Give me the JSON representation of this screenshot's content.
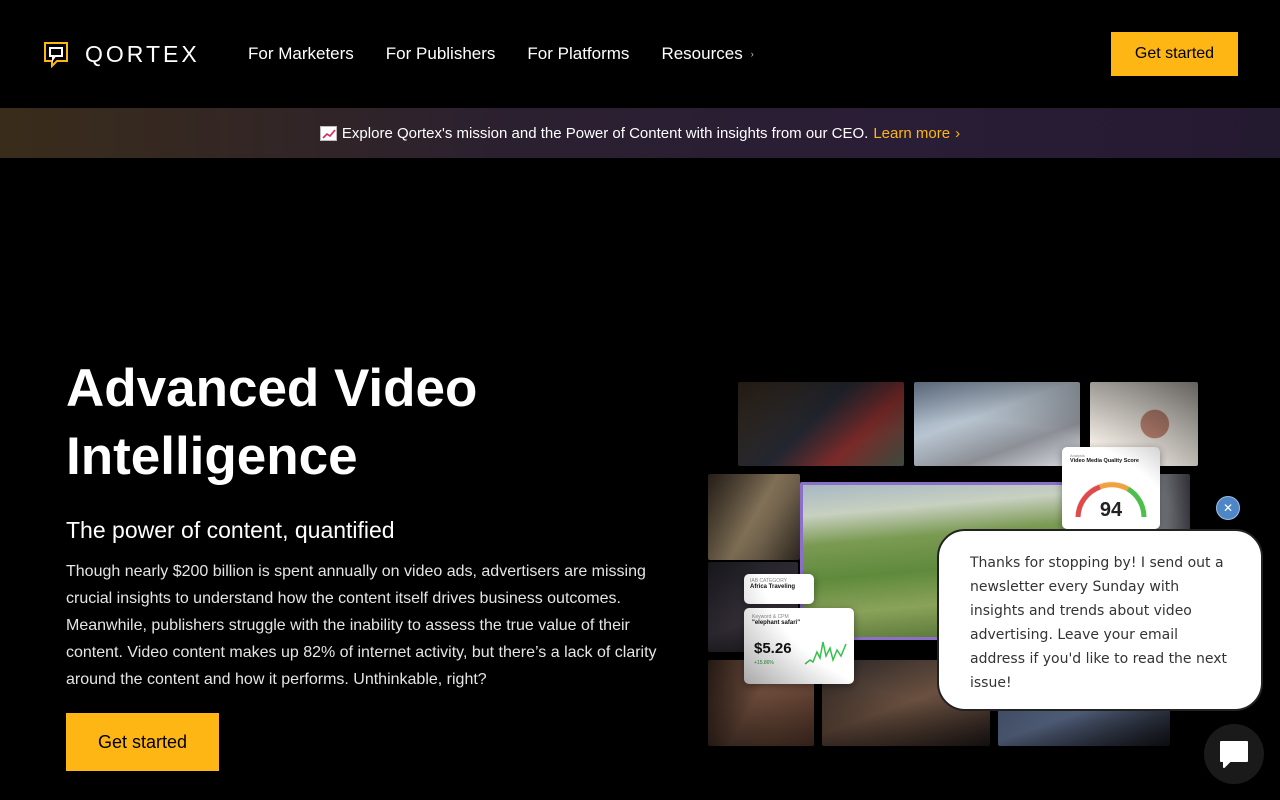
{
  "brand": {
    "name": "QORTEX",
    "accent_color": "#fdb614"
  },
  "nav": {
    "items": [
      {
        "label": "For Marketers"
      },
      {
        "label": "For Publishers"
      },
      {
        "label": "For Platforms"
      },
      {
        "label": "Resources",
        "icon": "chevron-right-icon"
      }
    ],
    "cta_label": "Get started"
  },
  "announcement": {
    "emoji_icon": "chart-increasing-icon",
    "text": "Explore Qortex's mission and the Power of Content with insights from our CEO.",
    "link_label": "Learn more",
    "link_icon": "chevron-right-icon"
  },
  "hero": {
    "title": "Advanced Video Intelligence",
    "subtitle": "The power of content, quantified",
    "body": "Though nearly $200 billion is spent annually on video ads, advertisers are missing crucial insights to understand how the content itself drives business outcomes. Meanwhile, publishers struggle with the inability to assess the true value of their content. Video content makes up 82% of internet activity, but there’s a lack of clarity around the content and how it performs. Unthinkable, right?",
    "cta_label": "Get started"
  },
  "collage": {
    "score_card": {
      "title": "Video Media Quality Score",
      "value": "94"
    },
    "category_card": {
      "label": "IAB CATEGORY",
      "value": "Africa Traveling"
    },
    "keyword_card": {
      "label": "Keyword & CPM",
      "keyword": "\"elephant safari\"",
      "price": "$5.26",
      "change": "+15.86%"
    }
  },
  "chat": {
    "message": "Thanks for stopping by! I send out a newsletter every Sunday with insights and trends about video advertising. Leave your email address if you'd like to read the next issue!",
    "close_icon": "close-icon",
    "launcher_icon": "chat-bubble-icon"
  }
}
